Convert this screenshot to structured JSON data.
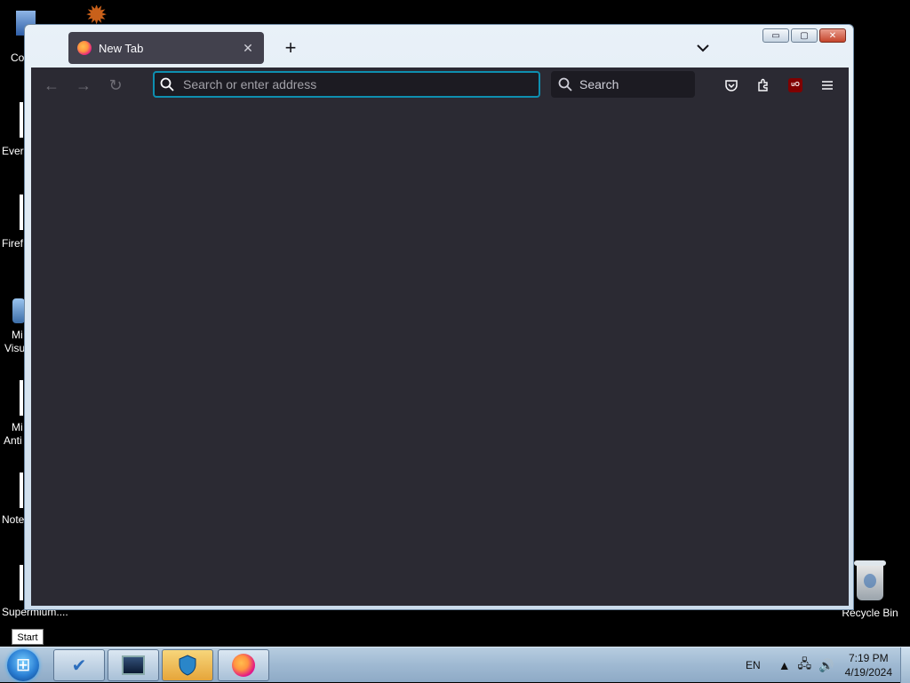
{
  "desktop": {
    "icons": [
      {
        "label": "Co"
      },
      {
        "label": "Ever"
      },
      {
        "label": "Firef"
      },
      {
        "label": "Mi",
        "label2": "Visu"
      },
      {
        "label": "Mi",
        "label2": "Anti"
      },
      {
        "label": "Note"
      },
      {
        "label": "Supermium...."
      }
    ],
    "recycle_bin": "Recycle Bin"
  },
  "browser": {
    "tab_title": "New Tab",
    "tab_close": "✕",
    "new_tab": "+",
    "list_all_tabs": "⌄",
    "back": "←",
    "forward": "→",
    "reload": "↻",
    "url_placeholder": "Search or enter address",
    "search_label": "Search",
    "window_buttons": {
      "minimize": "▭",
      "restore": "▢",
      "close": "✕"
    },
    "toolbar_icons": [
      "pocket-icon",
      "extensions-icon",
      "ublock-icon",
      "menu-icon"
    ],
    "ublock_text": "uO"
  },
  "taskbar": {
    "start_tooltip": "Start",
    "language": "EN",
    "time": "7:19 PM",
    "date": "4/19/2024"
  }
}
